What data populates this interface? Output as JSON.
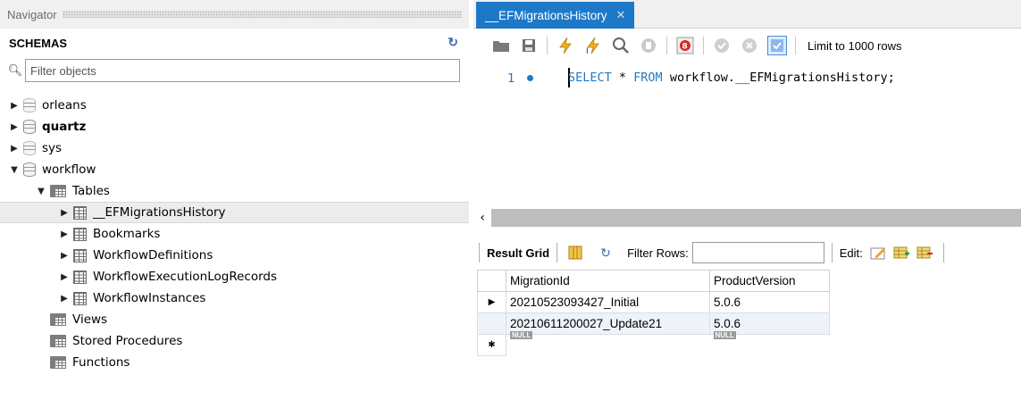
{
  "navigator": {
    "title": "Navigator",
    "schemas_label": "SCHEMAS",
    "filter_placeholder": "Filter objects",
    "schemas": [
      {
        "name": "orleans",
        "bold": false
      },
      {
        "name": "quartz",
        "bold": true
      },
      {
        "name": "sys",
        "bold": false
      },
      {
        "name": "workflow",
        "bold": false
      }
    ],
    "workflow": {
      "tables_label": "Tables",
      "tables": [
        "__EFMigrationsHistory",
        "Bookmarks",
        "WorkflowDefinitions",
        "WorkflowExecutionLogRecords",
        "WorkflowInstances"
      ],
      "views_label": "Views",
      "procedures_label": "Stored Procedures",
      "functions_label": "Functions"
    }
  },
  "editor": {
    "tab_title": "__EFMigrationsHistory",
    "limit_label": "Limit to 1000 rows",
    "line_number": "1",
    "code_keyword1": "SELECT",
    "code_mid": " * ",
    "code_keyword2": "FROM",
    "code_rest": " workflow.__EFMigrationsHistory;"
  },
  "results": {
    "result_grid_label": "Result Grid",
    "filter_rows_label": "Filter Rows:",
    "edit_label": "Edit:",
    "columns": [
      "MigrationId",
      "ProductVersion"
    ],
    "rows": [
      [
        "20210523093427_Initial",
        "5.0.6"
      ],
      [
        "20210611200027_Update21",
        "5.0.6"
      ]
    ],
    "null_label": "NULL"
  },
  "colors": {
    "accent": "#1e78c8",
    "keyword": "#1f7ac3"
  }
}
